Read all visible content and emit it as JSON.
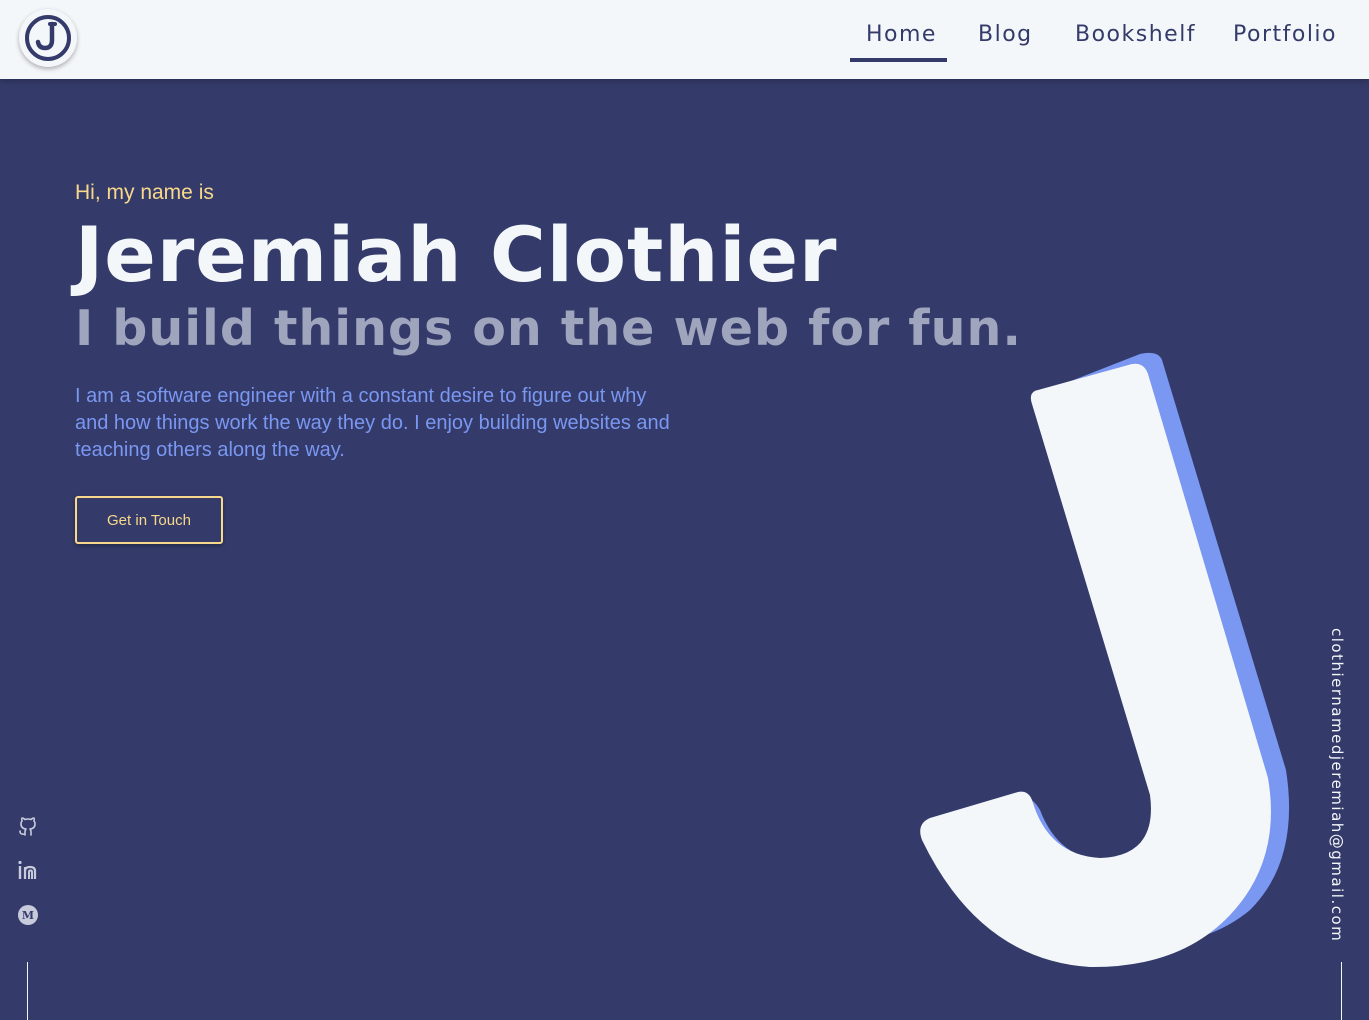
{
  "header": {
    "logo_alt": "J",
    "nav": [
      {
        "label": "Home",
        "active": true
      },
      {
        "label": "Blog",
        "active": false
      },
      {
        "label": "Bookshelf",
        "active": false
      },
      {
        "label": "Portfolio",
        "active": false
      }
    ]
  },
  "hero": {
    "greeting": "Hi, my name is",
    "name": "Jeremiah Clothier",
    "tagline": "I build things on the web for fun.",
    "bio": "I am a software engineer with a constant desire to figure out why and how things work the way they do. I enjoy building websites and teaching others along the way.",
    "cta_label": "Get in Touch"
  },
  "social": [
    {
      "icon": "github-icon"
    },
    {
      "icon": "linkedin-icon"
    },
    {
      "icon": "medium-icon"
    }
  ],
  "email": "clothiernamedjeremiah@gmail.com",
  "colors": {
    "navy": "#343b6a",
    "off_white": "#f4f7fa",
    "accent_yellow": "#f8d88a",
    "accent_blue": "#7a97f2",
    "muted_gray": "#a0a5be"
  }
}
